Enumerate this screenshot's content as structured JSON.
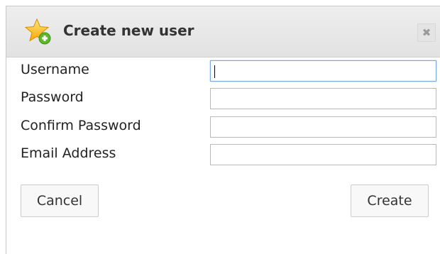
{
  "dialog": {
    "title": "Create new user",
    "title_icon": "star-add-icon",
    "close_icon": "close-icon",
    "close_glyph": "✖"
  },
  "form": {
    "username": {
      "label": "Username",
      "value": ""
    },
    "password": {
      "label": "Password",
      "value": ""
    },
    "confirm_password": {
      "label": "Confirm Password",
      "value": ""
    },
    "email": {
      "label": "Email Address",
      "value": ""
    }
  },
  "buttons": {
    "cancel": "Cancel",
    "create": "Create"
  },
  "colors": {
    "focus_border": "#7aa7e0",
    "titlebar": "#e6e6e6",
    "star": "#f5b400",
    "plus": "#5cb82a"
  }
}
